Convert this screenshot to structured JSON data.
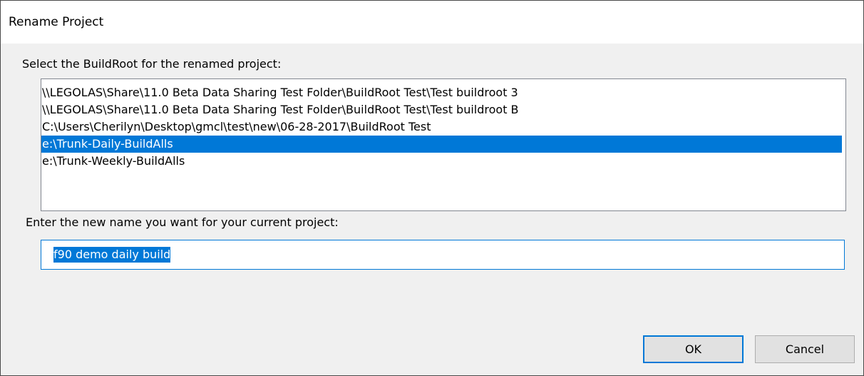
{
  "window": {
    "title": "Rename Project"
  },
  "buildroot": {
    "label": "Select the BuildRoot for the renamed project:",
    "items": [
      {
        "label": "\\\\LEGOLAS\\Share\\11.0 Beta Data Sharing Test Folder\\BuildRoot Test\\Test buildroot 3",
        "selected": false
      },
      {
        "label": "\\\\LEGOLAS\\Share\\11.0 Beta Data Sharing Test Folder\\BuildRoot Test\\Test buildroot B",
        "selected": false
      },
      {
        "label": "C:\\Users\\Cherilyn\\Desktop\\gmcl\\test\\new\\06-28-2017\\BuildRoot Test",
        "selected": false
      },
      {
        "label": "e:\\Trunk-Daily-BuildAlls",
        "selected": true
      },
      {
        "label": "e:\\Trunk-Weekly-BuildAlls",
        "selected": false
      }
    ]
  },
  "project_name": {
    "label": "Enter the new name you want for your current project:",
    "value": "f90 demo daily build"
  },
  "buttons": {
    "ok_label": "OK",
    "cancel_label": "Cancel"
  },
  "colors": {
    "selection": "#0078d7",
    "dialog_background": "#f0f0f0",
    "title_background": "#ffffff"
  }
}
